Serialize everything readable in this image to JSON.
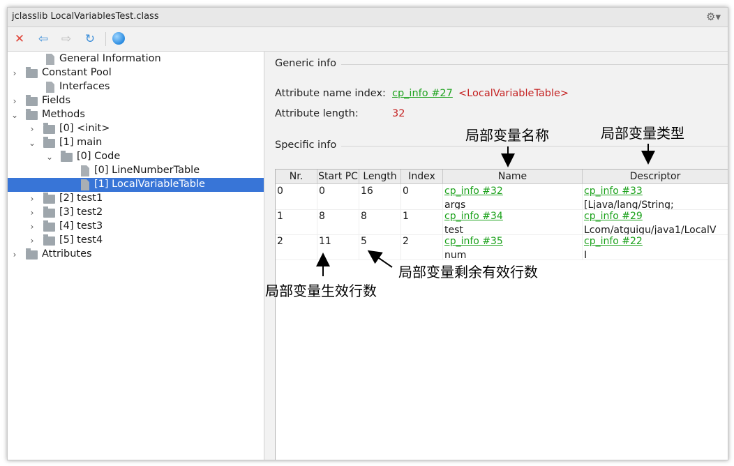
{
  "window": {
    "title": "jclasslib LocalVariablesTest.class"
  },
  "icons": {
    "gear": "gear-icon",
    "close": "close-icon",
    "back": "back-arrow-icon",
    "forward": "forward-arrow-icon",
    "refresh": "refresh-icon",
    "web": "web-icon"
  },
  "tree": [
    {
      "label": "General Information",
      "kind": "file"
    },
    {
      "label": "Constant Pool",
      "kind": "folder"
    },
    {
      "label": "Interfaces",
      "kind": "file"
    },
    {
      "label": "Fields",
      "kind": "folder"
    },
    {
      "label": "Methods",
      "kind": "folder"
    },
    {
      "label": "[0] <init>",
      "kind": "folder"
    },
    {
      "label": "[1] main",
      "kind": "folder"
    },
    {
      "label": "[0] Code",
      "kind": "folder"
    },
    {
      "label": "[0] LineNumberTable",
      "kind": "file"
    },
    {
      "label": "[1] LocalVariableTable",
      "kind": "file",
      "selected": true
    },
    {
      "label": "[2] test1",
      "kind": "folder"
    },
    {
      "label": "[3] test2",
      "kind": "folder"
    },
    {
      "label": "[4] test3",
      "kind": "folder"
    },
    {
      "label": "[5] test4",
      "kind": "folder"
    },
    {
      "label": "Attributes",
      "kind": "folder"
    }
  ],
  "generic": {
    "section_title": "Generic info",
    "name_index_label": "Attribute name index:",
    "name_index_link": "cp_info #27",
    "name_index_value": "<LocalVariableTable>",
    "length_label": "Attribute length:",
    "length_value": "32"
  },
  "specific": {
    "section_title": "Specific info",
    "headers": [
      "Nr.",
      "Start PC",
      "Length",
      "Index",
      "Name",
      "Descriptor"
    ],
    "rows": [
      {
        "nr": "0",
        "start_pc": "0",
        "length": "16",
        "index": "0",
        "name_link": "cp_info #32",
        "name_value": "args",
        "desc_link": "cp_info #33",
        "desc_value": "[Ljava/lang/String;"
      },
      {
        "nr": "1",
        "start_pc": "8",
        "length": "8",
        "index": "1",
        "name_link": "cp_info #34",
        "name_value": "test",
        "desc_link": "cp_info #29",
        "desc_value": "Lcom/atguigu/java1/LocalV"
      },
      {
        "nr": "2",
        "start_pc": "11",
        "length": "5",
        "index": "2",
        "name_link": "cp_info #35",
        "name_value": "num",
        "desc_link": "cp_info #22",
        "desc_value": "I"
      }
    ]
  },
  "annotations": {
    "name": "局部变量名称",
    "type": "局部变量类型",
    "remaining": "局部变量剩余有效行数",
    "start": "局部变量生效行数"
  }
}
